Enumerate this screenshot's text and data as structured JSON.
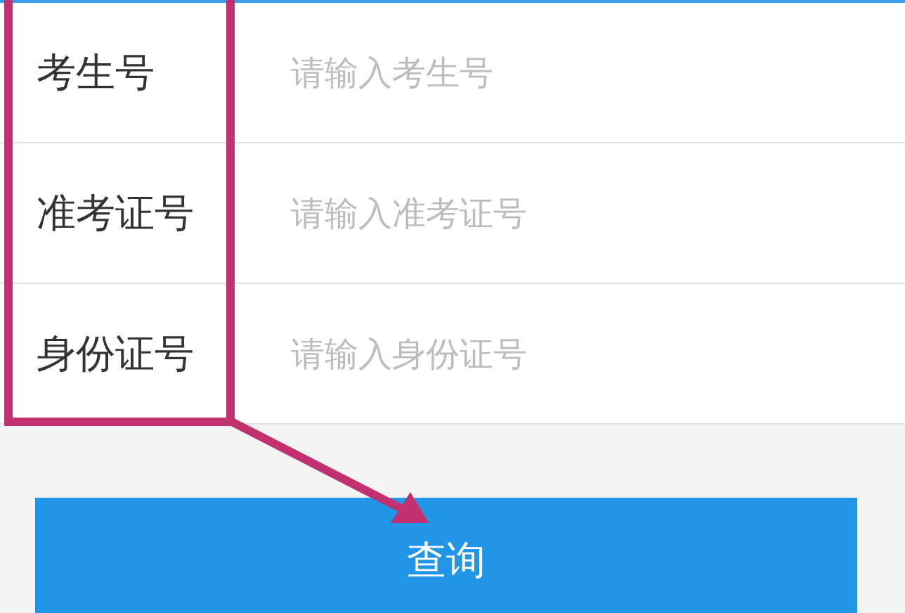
{
  "fields": [
    {
      "label": "考生号",
      "placeholder": "请输入考生号"
    },
    {
      "label": "准考证号",
      "placeholder": "请输入准考证号"
    },
    {
      "label": "身份证号",
      "placeholder": "请输入身份证号"
    }
  ],
  "submit_button": "查询"
}
